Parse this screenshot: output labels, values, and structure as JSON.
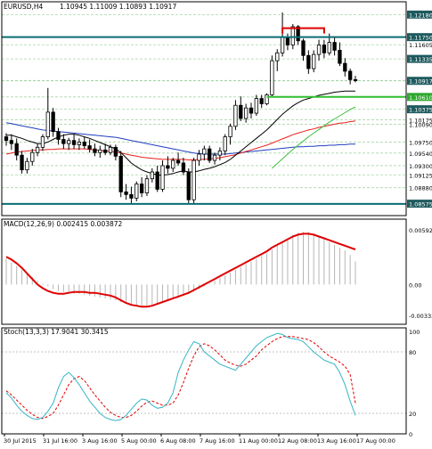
{
  "colors": {
    "background": "#ffffff",
    "border": "#000000",
    "bull_candle": "#ffffff",
    "bear_candle": "#000000",
    "ma_black": "#000000",
    "ma_red": "#e8211c",
    "ma_blue": "#1f3fbf",
    "ma_green": "#3cbf3c",
    "teal_level": "#0a6d73",
    "green_level": "#2fbf2f",
    "red_level": "#e00000",
    "macd_signal": "#e00000",
    "macd_hist": "#b5b5b5",
    "stoch_main": "#35b5c5",
    "stoch_signal": "#e00000",
    "grid_dash": "#a9d5a9",
    "price_tag_dark": "#1e5a5e",
    "price_tag_green": "#2fa82f"
  },
  "chart_data": [
    {
      "type": "candlestick",
      "title": "EURUSD,H4",
      "ohlc_label": "1.10945 1.11009 1.10893 1.10917",
      "ylim": [
        1.0845,
        1.1222
      ],
      "price_ticks": [
        "1.12180",
        "1.11750",
        "1.11605",
        "1.11335",
        "1.10925",
        "1.10917",
        "1.10610",
        "1.10375",
        "1.10175",
        "1.10090",
        "1.09750",
        "1.09540",
        "1.09300",
        "1.09125",
        "1.08880",
        "1.08575"
      ],
      "price_tag_dark": [
        "1.12180",
        "1.11750",
        "1.11335",
        "1.10917",
        "1.10375",
        "1.08575"
      ],
      "price_tag_green": [
        "1.10610"
      ],
      "ohlc": [
        [
          1.0985,
          1.0992,
          1.0968,
          1.0978
        ],
        [
          1.0978,
          1.099,
          1.096,
          1.0972
        ],
        [
          1.0972,
          1.0982,
          1.094,
          1.095
        ],
        [
          1.095,
          1.0958,
          1.0915,
          1.0922
        ],
        [
          1.0922,
          1.0945,
          1.0915,
          1.0938
        ],
        [
          1.0938,
          1.0962,
          1.093,
          1.0955
        ],
        [
          1.0955,
          1.0972,
          1.0948,
          1.0965
        ],
        [
          1.0965,
          1.099,
          1.0958,
          1.0985
        ],
        [
          1.0985,
          1.1078,
          1.098,
          1.1032
        ],
        [
          1.1032,
          1.104,
          1.0985,
          1.0995
        ],
        [
          1.0995,
          1.1002,
          1.097,
          1.098
        ],
        [
          1.098,
          1.099,
          1.0962,
          1.0972
        ],
        [
          1.0972,
          1.0983,
          1.096,
          1.0978
        ],
        [
          1.0978,
          1.099,
          1.0962,
          1.097
        ],
        [
          1.097,
          1.0982,
          1.096,
          1.0975
        ],
        [
          1.0975,
          1.0985,
          1.0962,
          1.0968
        ],
        [
          1.0968,
          1.098,
          1.0955,
          1.0962
        ],
        [
          1.0962,
          1.0972,
          1.0948,
          1.0955
        ],
        [
          1.0955,
          1.0968,
          1.0945,
          1.096
        ],
        [
          1.096,
          1.0972,
          1.095,
          1.0955
        ],
        [
          1.0955,
          1.097,
          1.095,
          1.0965
        ],
        [
          1.0965,
          1.097,
          1.094,
          1.0948
        ],
        [
          1.0948,
          1.0958,
          1.087,
          1.088
        ],
        [
          1.088,
          1.0895,
          1.0865,
          1.0875
        ],
        [
          1.0875,
          1.089,
          1.0858,
          1.0868
        ],
        [
          1.0868,
          1.09,
          1.0862,
          1.0895
        ],
        [
          1.0895,
          1.0908,
          1.087,
          1.0878
        ],
        [
          1.0878,
          1.0912,
          1.0872,
          1.0905
        ],
        [
          1.0905,
          1.0925,
          1.0898,
          1.0918
        ],
        [
          1.0918,
          1.093,
          1.088,
          1.0885
        ],
        [
          1.0885,
          1.094,
          1.088,
          1.093
        ],
        [
          1.093,
          1.0948,
          1.0915,
          1.0925
        ],
        [
          1.0925,
          1.0945,
          1.0918,
          1.094
        ],
        [
          1.094,
          1.0955,
          1.093,
          1.0935
        ],
        [
          1.0935,
          1.0945,
          1.0912,
          1.0918
        ],
        [
          1.0918,
          1.0925,
          1.0858,
          1.0865
        ],
        [
          1.0865,
          1.0945,
          1.0858,
          1.094
        ],
        [
          1.094,
          1.096,
          1.093,
          1.0952
        ],
        [
          1.0952,
          1.0968,
          1.094,
          1.0962
        ],
        [
          1.0962,
          1.0968,
          1.0935,
          1.094
        ],
        [
          1.094,
          1.0955,
          1.0932,
          1.095
        ],
        [
          1.095,
          1.0965,
          1.094,
          1.0958
        ],
        [
          1.0958,
          1.099,
          1.095,
          1.0985
        ],
        [
          1.0985,
          1.101,
          1.097,
          1.1005
        ],
        [
          1.1005,
          1.1055,
          1.0998,
          1.1045
        ],
        [
          1.1045,
          1.1062,
          1.1015,
          1.102
        ],
        [
          1.102,
          1.1048,
          1.1012,
          1.104
        ],
        [
          1.104,
          1.105,
          1.102,
          1.103
        ],
        [
          1.103,
          1.1065,
          1.1025,
          1.1058
        ],
        [
          1.1058,
          1.1065,
          1.104,
          1.1048
        ],
        [
          1.1048,
          1.1068,
          1.1045,
          1.1065
        ],
        [
          1.1065,
          1.114,
          1.106,
          1.113
        ],
        [
          1.113,
          1.1152,
          1.111,
          1.1145
        ],
        [
          1.1145,
          1.1222,
          1.1138,
          1.1175
        ],
        [
          1.1175,
          1.1182,
          1.115,
          1.116
        ],
        [
          1.116,
          1.12,
          1.1152,
          1.1195
        ],
        [
          1.1195,
          1.1198,
          1.116,
          1.1168
        ],
        [
          1.1168,
          1.1172,
          1.113,
          1.114
        ],
        [
          1.114,
          1.115,
          1.1105,
          1.1115
        ],
        [
          1.1115,
          1.115,
          1.1108,
          1.1142
        ],
        [
          1.1142,
          1.117,
          1.113,
          1.116
        ],
        [
          1.116,
          1.117,
          1.1135,
          1.1145
        ],
        [
          1.1145,
          1.1182,
          1.114,
          1.1165
        ],
        [
          1.1165,
          1.1175,
          1.114,
          1.115
        ],
        [
          1.115,
          1.1165,
          1.112,
          1.1125
        ],
        [
          1.1125,
          1.1135,
          1.11,
          1.111
        ],
        [
          1.111,
          1.1115,
          1.1085,
          1.1094
        ],
        [
          1.1094,
          1.1101,
          1.1089,
          1.1092
        ]
      ],
      "ma_black": [
        1.0988,
        1.0988,
        1.0985,
        1.0982,
        1.0978,
        1.0975,
        1.0972,
        1.0972,
        1.0975,
        1.098,
        1.0985,
        1.0988,
        1.099,
        1.099,
        1.0988,
        1.0985,
        1.0982,
        1.0978,
        1.0974,
        1.097,
        1.0966,
        1.0962,
        1.0955,
        1.0945,
        1.0935,
        1.0928,
        1.0922,
        1.0918,
        1.0915,
        1.0912,
        1.0912,
        1.0913,
        1.0915,
        1.0918,
        1.092,
        1.0918,
        1.0918,
        1.092,
        1.0923,
        1.0925,
        1.0928,
        1.0932,
        1.0936,
        1.0942,
        1.095,
        1.0958,
        1.0966,
        1.0974,
        1.0982,
        1.099,
        1.0998,
        1.1008,
        1.1018,
        1.1028,
        1.1036,
        1.1044,
        1.105,
        1.1055,
        1.1058,
        1.1061,
        1.1064,
        1.1066,
        1.1068,
        1.107,
        1.1071,
        1.1072,
        1.1072,
        1.1072
      ],
      "ma_red": [
        1.0952,
        1.0954,
        1.0956,
        1.0957,
        1.0958,
        1.0959,
        1.096,
        1.096,
        1.0961,
        1.0961,
        1.0962,
        1.0962,
        1.0962,
        1.0962,
        1.0962,
        1.0962,
        1.0961,
        1.096,
        1.0959,
        1.0958,
        1.0957,
        1.0956,
        1.0954,
        1.0952,
        1.095,
        1.0948,
        1.0946,
        1.0945,
        1.0944,
        1.0943,
        1.0942,
        1.0942,
        1.0942,
        1.0942,
        1.0942,
        1.0941,
        1.0941,
        1.0942,
        1.0942,
        1.0943,
        1.0944,
        1.0945,
        1.0947,
        1.0949,
        1.0951,
        1.0954,
        1.0957,
        1.096,
        1.0963,
        1.0966,
        1.0969,
        1.0973,
        1.0977,
        1.0981,
        1.0985,
        1.0989,
        1.0992,
        1.0995,
        1.0998,
        1.1,
        1.1003,
        1.1005,
        1.1007,
        1.1009,
        1.1011,
        1.1012,
        1.1014,
        1.1015
      ],
      "ma_blue": [
        1.1012,
        1.101,
        1.1008,
        1.1006,
        1.1004,
        1.1002,
        1.1,
        1.0998,
        1.0997,
        1.0996,
        1.0995,
        1.0994,
        1.0993,
        1.0992,
        1.0991,
        1.099,
        1.0989,
        1.0988,
        1.0987,
        1.0986,
        1.0985,
        1.0984,
        1.0982,
        1.098,
        1.0978,
        1.0976,
        1.0974,
        1.0972,
        1.097,
        1.0968,
        1.0966,
        1.0964,
        1.0962,
        1.096,
        1.0958,
        1.0956,
        1.0954,
        1.0953,
        1.0952,
        1.0952,
        1.0952,
        1.0952,
        1.0952,
        1.0953,
        1.0954,
        1.0955,
        1.0956,
        1.0957,
        1.0958,
        1.0959,
        1.096,
        1.0961,
        1.0962,
        1.0963,
        1.0964,
        1.0965,
        1.0966,
        1.0966,
        1.0967,
        1.0967,
        1.0968,
        1.0968,
        1.0969,
        1.0969,
        1.097,
        1.097,
        1.0971,
        1.0971
      ],
      "ma_green": [
        null,
        null,
        null,
        null,
        null,
        null,
        null,
        null,
        null,
        null,
        null,
        null,
        null,
        null,
        null,
        null,
        null,
        null,
        null,
        null,
        null,
        null,
        null,
        null,
        null,
        null,
        null,
        null,
        null,
        null,
        null,
        null,
        null,
        null,
        null,
        null,
        null,
        null,
        null,
        null,
        null,
        null,
        null,
        null,
        null,
        null,
        null,
        null,
        null,
        null,
        null,
        1.0925,
        1.0934,
        1.0943,
        1.0952,
        1.0961,
        1.0969,
        1.0977,
        1.0985,
        1.0992,
        1.0999,
        1.1006,
        1.1013,
        1.1019,
        1.1025,
        1.1031,
        1.1037,
        1.1042
      ],
      "levels": {
        "teal": [
          1.1175,
          1.0857
        ],
        "green": 1.1061,
        "red": 1.1192
      },
      "green_level_start_index": 50,
      "red_level_range": [
        53,
        61
      ]
    },
    {
      "type": "histogram+line",
      "title": "MACD(12,26,9) 0.002415 0.003872",
      "ylim": [
        -0.00334,
        0.00592
      ],
      "ticks": [
        "0.005921",
        "0.00",
        "-0.003334"
      ],
      "hist": [
        0.0028,
        0.0024,
        0.002,
        0.0016,
        0.0012,
        0.0008,
        0.0004,
        0.0001,
        -0.0002,
        -0.0005,
        -0.0007,
        -0.0008,
        -0.0009,
        -0.001,
        -0.001,
        -0.0011,
        -0.0012,
        -0.0013,
        -0.0014,
        -0.0015,
        -0.0016,
        -0.0017,
        -0.0019,
        -0.0021,
        -0.0023,
        -0.0024,
        -0.0024,
        -0.0024,
        -0.0023,
        -0.0022,
        -0.002,
        -0.0018,
        -0.0016,
        -0.0014,
        -0.0012,
        -0.001,
        -0.0008,
        -0.0005,
        -0.0002,
        0.0001,
        0.0004,
        0.0007,
        0.001,
        0.0013,
        0.0016,
        0.0019,
        0.0022,
        0.0025,
        0.0028,
        0.0031,
        0.0034,
        0.0038,
        0.0042,
        0.0046,
        0.005,
        0.0054,
        0.0056,
        0.0057,
        0.0057,
        0.0055,
        0.0052,
        0.0049,
        0.0046,
        0.0043,
        0.004,
        0.0037,
        0.0032,
        0.0025
      ],
      "signal": [
        0.003,
        0.0027,
        0.0023,
        0.0018,
        0.0012,
        0.0006,
        0.0,
        -0.0004,
        -0.0007,
        -0.0009,
        -0.001,
        -0.001,
        -0.0009,
        -0.0008,
        -0.0008,
        -0.0008,
        -0.0009,
        -0.0009,
        -0.001,
        -0.0011,
        -0.0012,
        -0.0014,
        -0.0017,
        -0.002,
        -0.0022,
        -0.0023,
        -0.0024,
        -0.0024,
        -0.0023,
        -0.0021,
        -0.0019,
        -0.0017,
        -0.0015,
        -0.0013,
        -0.0011,
        -0.0009,
        -0.0006,
        -0.0003,
        0.0,
        0.0003,
        0.0006,
        0.0009,
        0.0012,
        0.0015,
        0.0018,
        0.0021,
        0.0024,
        0.0027,
        0.003,
        0.0033,
        0.0036,
        0.004,
        0.0043,
        0.0046,
        0.0049,
        0.0052,
        0.0054,
        0.0055,
        0.0055,
        0.0054,
        0.0052,
        0.005,
        0.0048,
        0.0046,
        0.0044,
        0.0042,
        0.004,
        0.0038
      ]
    },
    {
      "type": "line",
      "title": "Stoch(13,3,3) 17.9041 30.3415",
      "ylim": [
        0,
        100
      ],
      "ticks": [
        "100",
        "80",
        "20",
        "0"
      ],
      "main": [
        40,
        35,
        28,
        22,
        18,
        15,
        14,
        16,
        22,
        30,
        45,
        56,
        60,
        55,
        48,
        40,
        32,
        26,
        20,
        16,
        14,
        13,
        14,
        18,
        24,
        30,
        34,
        33,
        28,
        25,
        26,
        30,
        40,
        60,
        72,
        82,
        90,
        88,
        80,
        76,
        72,
        68,
        66,
        64,
        62,
        68,
        74,
        80,
        86,
        90,
        94,
        96,
        98,
        97,
        94,
        93,
        92,
        90,
        85,
        80,
        76,
        72,
        70,
        68,
        60,
        48,
        32,
        18
      ],
      "signal": [
        42,
        38,
        33,
        28,
        23,
        19,
        16,
        15,
        17,
        20,
        28,
        38,
        48,
        54,
        56,
        52,
        45,
        38,
        32,
        26,
        21,
        18,
        16,
        16,
        18,
        22,
        27,
        31,
        32,
        30,
        28,
        28,
        30,
        38,
        50,
        64,
        76,
        85,
        88,
        86,
        82,
        77,
        72,
        69,
        67,
        66,
        68,
        72,
        76,
        82,
        86,
        90,
        93,
        95,
        95,
        95,
        94,
        93,
        92,
        89,
        85,
        80,
        76,
        73,
        70,
        66,
        58,
        30
      ]
    }
  ],
  "time_labels": [
    "30 Jul 2015",
    "31 Jul 16:00",
    "3 Aug 16:00",
    "5 Aug 00:00",
    "6 Aug 08:00",
    "7 Aug 16:00",
    "11 Aug 00:00",
    "12 Aug 08:00",
    "13 Aug 16:00",
    "17 Aug 00:00"
  ]
}
